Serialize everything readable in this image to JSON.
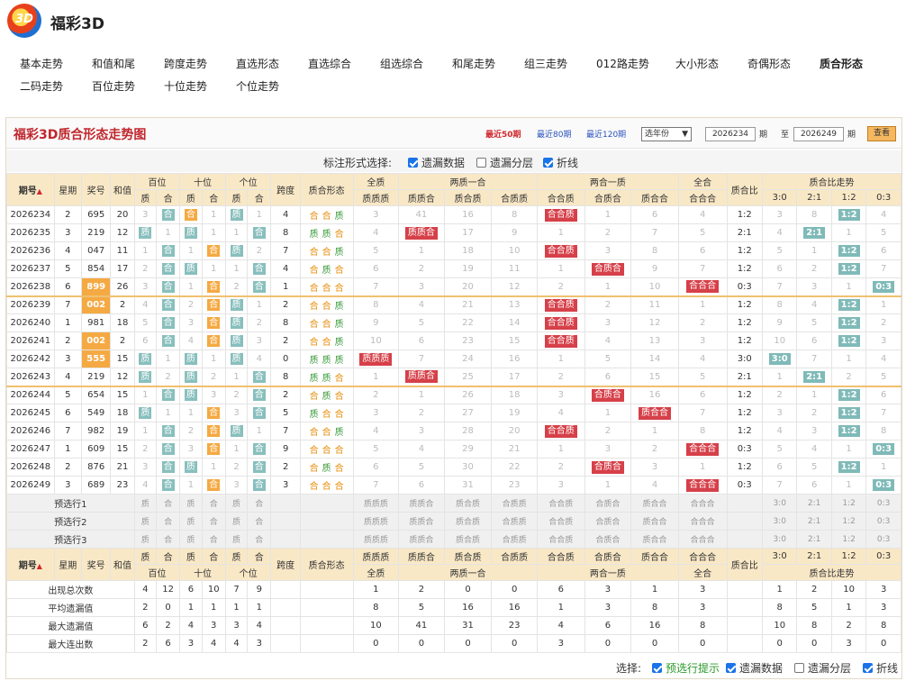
{
  "site": {
    "title": "福彩3D",
    "logo_text": "3D"
  },
  "nav": [
    {
      "label": "基本走势",
      "active": false
    },
    {
      "label": "和值和尾",
      "active": false
    },
    {
      "label": "跨度走势",
      "active": false
    },
    {
      "label": "直选形态",
      "active": false
    },
    {
      "label": "直选综合",
      "active": false
    },
    {
      "label": "组选综合",
      "active": false
    },
    {
      "label": "和尾走势",
      "active": false
    },
    {
      "label": "组三走势",
      "active": false
    },
    {
      "label": "012路走势",
      "active": false
    },
    {
      "label": "大小形态",
      "active": false
    },
    {
      "label": "奇偶形态",
      "active": false
    },
    {
      "label": "质合形态",
      "active": true
    },
    {
      "label": "二码走势",
      "active": false
    },
    {
      "label": "百位走势",
      "active": false
    },
    {
      "label": "十位走势",
      "active": false
    },
    {
      "label": "个位走势",
      "active": false
    }
  ],
  "panel": {
    "title": "福彩3D质合形态走势图",
    "ranges": [
      {
        "label": "最近50期",
        "active": true
      },
      {
        "label": "最近80期",
        "active": false
      },
      {
        "label": "最近120期",
        "active": false
      }
    ],
    "year_select": "选年份",
    "from_label": "期",
    "to_label": "至",
    "period_unit": "期",
    "period_from": "2026234",
    "period_to": "2026249",
    "view_button": "查看"
  },
  "mark": {
    "label": "标注形式选择:",
    "options": [
      {
        "label": "遗漏数据",
        "checked": true
      },
      {
        "label": "遗漏分层",
        "checked": false
      },
      {
        "label": "折线",
        "checked": true
      }
    ]
  },
  "header": {
    "period": "期号",
    "weekday": "星期",
    "number": "奖号",
    "sum": "和值",
    "hundreds": "百位",
    "tens": "十位",
    "units": "个位",
    "span": "跨度",
    "form": "质合形态",
    "all_prime": "全质",
    "two_prime": "两质一合",
    "two_comp": "两合一质",
    "all_comp": "全合",
    "ratio": "质合比",
    "ratio_trend": "质合比走势",
    "prime": "质",
    "comp": "合",
    "ppp": "质质质",
    "ppc": "质质合",
    "pcp": "质合质",
    "cpp": "合质质",
    "ccp": "合合质",
    "cpc": "合质合",
    "pcc": "质合合",
    "ccc": "合合合",
    "r30": "3:0",
    "r21": "2:1",
    "r12": "1:2",
    "r03": "0:3"
  },
  "rows": [
    {
      "period": "2026234",
      "weekday": "2",
      "number": "695",
      "sum": "20",
      "hl": false,
      "h": [
        "3",
        "合"
      ],
      "t": [
        "合",
        "1"
      ],
      "u": [
        "质",
        "1"
      ],
      "span": "4",
      "form": [
        "合",
        "合",
        "质"
      ],
      "cat": [
        "3",
        "41",
        "16",
        "8",
        "合合质",
        "1",
        "6",
        "4"
      ],
      "ratio": "1:2",
      "rt": [
        "3",
        "8",
        "1:2",
        "4"
      ]
    },
    {
      "period": "2026235",
      "weekday": "3",
      "number": "219",
      "sum": "12",
      "hl": false,
      "h": [
        "质",
        "1"
      ],
      "t": [
        "质",
        "1"
      ],
      "u": [
        "1",
        "合"
      ],
      "span": "8",
      "form": [
        "质",
        "质",
        "合"
      ],
      "cat": [
        "4",
        "质质合",
        "17",
        "9",
        "1",
        "2",
        "7",
        "5"
      ],
      "ratio": "2:1",
      "rt": [
        "4",
        "2:1",
        "1",
        "5"
      ]
    },
    {
      "period": "2026236",
      "weekday": "4",
      "number": "047",
      "sum": "11",
      "hl": false,
      "h": [
        "1",
        "合"
      ],
      "t": [
        "1",
        "合"
      ],
      "u": [
        "质",
        "2"
      ],
      "span": "7",
      "form": [
        "合",
        "合",
        "质"
      ],
      "cat": [
        "5",
        "1",
        "18",
        "10",
        "合合质",
        "3",
        "8",
        "6"
      ],
      "ratio": "1:2",
      "rt": [
        "5",
        "1",
        "1:2",
        "6"
      ]
    },
    {
      "period": "2026237",
      "weekday": "5",
      "number": "854",
      "sum": "17",
      "hl": false,
      "h": [
        "2",
        "合"
      ],
      "t": [
        "质",
        "1"
      ],
      "u": [
        "1",
        "合"
      ],
      "span": "4",
      "form": [
        "合",
        "质",
        "合"
      ],
      "cat": [
        "6",
        "2",
        "19",
        "11",
        "1",
        "合质合",
        "9",
        "7"
      ],
      "ratio": "1:2",
      "rt": [
        "6",
        "2",
        "1:2",
        "7"
      ]
    },
    {
      "period": "2026238",
      "weekday": "6",
      "number": "899",
      "sum": "26",
      "hl": true,
      "h": [
        "3",
        "合"
      ],
      "t": [
        "1",
        "合"
      ],
      "u": [
        "2",
        "合"
      ],
      "span": "1",
      "form": [
        "合",
        "合",
        "合"
      ],
      "cat": [
        "7",
        "3",
        "20",
        "12",
        "2",
        "1",
        "10",
        "合合合"
      ],
      "ratio": "0:3",
      "rt": [
        "7",
        "3",
        "1",
        "0:3"
      ]
    },
    {
      "period": "2026239",
      "weekday": "7",
      "number": "002",
      "sum": "2",
      "hl": true,
      "h": [
        "4",
        "合"
      ],
      "t": [
        "2",
        "合"
      ],
      "u": [
        "质",
        "1"
      ],
      "span": "2",
      "form": [
        "合",
        "合",
        "质"
      ],
      "cat": [
        "8",
        "4",
        "21",
        "13",
        "合合质",
        "2",
        "11",
        "1"
      ],
      "ratio": "1:2",
      "rt": [
        "8",
        "4",
        "1:2",
        "1"
      ]
    },
    {
      "period": "2026240",
      "weekday": "1",
      "number": "981",
      "sum": "18",
      "hl": false,
      "h": [
        "5",
        "合"
      ],
      "t": [
        "3",
        "合"
      ],
      "u": [
        "质",
        "2"
      ],
      "span": "8",
      "form": [
        "合",
        "合",
        "质"
      ],
      "cat": [
        "9",
        "5",
        "22",
        "14",
        "合合质",
        "3",
        "12",
        "2"
      ],
      "ratio": "1:2",
      "rt": [
        "9",
        "5",
        "1:2",
        "2"
      ]
    },
    {
      "period": "2026241",
      "weekday": "2",
      "number": "002",
      "sum": "2",
      "hl": true,
      "h": [
        "6",
        "合"
      ],
      "t": [
        "4",
        "合"
      ],
      "u": [
        "质",
        "3"
      ],
      "span": "2",
      "form": [
        "合",
        "合",
        "质"
      ],
      "cat": [
        "10",
        "6",
        "23",
        "15",
        "合合质",
        "4",
        "13",
        "3"
      ],
      "ratio": "1:2",
      "rt": [
        "10",
        "6",
        "1:2",
        "3"
      ]
    },
    {
      "period": "2026242",
      "weekday": "3",
      "number": "555",
      "sum": "15",
      "hl": true,
      "h": [
        "质",
        "1"
      ],
      "t": [
        "质",
        "1"
      ],
      "u": [
        "质",
        "4"
      ],
      "span": "0",
      "form": [
        "质",
        "质",
        "质"
      ],
      "cat": [
        "质质质",
        "7",
        "24",
        "16",
        "1",
        "5",
        "14",
        "4"
      ],
      "ratio": "3:0",
      "rt": [
        "3:0",
        "7",
        "1",
        "4"
      ]
    },
    {
      "period": "2026243",
      "weekday": "4",
      "number": "219",
      "sum": "12",
      "hl": false,
      "h": [
        "质",
        "2"
      ],
      "t": [
        "质",
        "2"
      ],
      "u": [
        "1",
        "合"
      ],
      "span": "8",
      "form": [
        "质",
        "质",
        "合"
      ],
      "cat": [
        "1",
        "质质合",
        "25",
        "17",
        "2",
        "6",
        "15",
        "5"
      ],
      "ratio": "2:1",
      "rt": [
        "1",
        "2:1",
        "2",
        "5"
      ]
    },
    {
      "period": "2026244",
      "weekday": "5",
      "number": "654",
      "sum": "15",
      "hl": false,
      "h": [
        "1",
        "合"
      ],
      "t": [
        "质",
        "3"
      ],
      "u": [
        "2",
        "合"
      ],
      "span": "2",
      "form": [
        "合",
        "质",
        "合"
      ],
      "cat": [
        "2",
        "1",
        "26",
        "18",
        "3",
        "合质合",
        "16",
        "6"
      ],
      "ratio": "1:2",
      "rt": [
        "2",
        "1",
        "1:2",
        "6"
      ]
    },
    {
      "period": "2026245",
      "weekday": "6",
      "number": "549",
      "sum": "18",
      "hl": false,
      "h": [
        "质",
        "1"
      ],
      "t": [
        "1",
        "合"
      ],
      "u": [
        "3",
        "合"
      ],
      "span": "5",
      "form": [
        "质",
        "合",
        "合"
      ],
      "cat": [
        "3",
        "2",
        "27",
        "19",
        "4",
        "1",
        "质合合",
        "7"
      ],
      "ratio": "1:2",
      "rt": [
        "3",
        "2",
        "1:2",
        "7"
      ]
    },
    {
      "period": "2026246",
      "weekday": "7",
      "number": "982",
      "sum": "19",
      "hl": false,
      "h": [
        "1",
        "合"
      ],
      "t": [
        "2",
        "合"
      ],
      "u": [
        "质",
        "1"
      ],
      "span": "7",
      "form": [
        "合",
        "合",
        "质"
      ],
      "cat": [
        "4",
        "3",
        "28",
        "20",
        "合合质",
        "2",
        "1",
        "8"
      ],
      "ratio": "1:2",
      "rt": [
        "4",
        "3",
        "1:2",
        "8"
      ]
    },
    {
      "period": "2026247",
      "weekday": "1",
      "number": "609",
      "sum": "15",
      "hl": false,
      "h": [
        "2",
        "合"
      ],
      "t": [
        "3",
        "合"
      ],
      "u": [
        "1",
        "合"
      ],
      "span": "9",
      "form": [
        "合",
        "合",
        "合"
      ],
      "cat": [
        "5",
        "4",
        "29",
        "21",
        "1",
        "3",
        "2",
        "合合合"
      ],
      "ratio": "0:3",
      "rt": [
        "5",
        "4",
        "1",
        "0:3"
      ]
    },
    {
      "period": "2026248",
      "weekday": "2",
      "number": "876",
      "sum": "21",
      "hl": false,
      "h": [
        "3",
        "合"
      ],
      "t": [
        "质",
        "1"
      ],
      "u": [
        "2",
        "合"
      ],
      "span": "2",
      "form": [
        "合",
        "质",
        "合"
      ],
      "cat": [
        "6",
        "5",
        "30",
        "22",
        "2",
        "合质合",
        "3",
        "1"
      ],
      "ratio": "1:2",
      "rt": [
        "6",
        "5",
        "1:2",
        "1"
      ]
    },
    {
      "period": "2026249",
      "weekday": "3",
      "number": "689",
      "sum": "23",
      "hl": false,
      "h": [
        "4",
        "合"
      ],
      "t": [
        "1",
        "合"
      ],
      "u": [
        "3",
        "合"
      ],
      "span": "3",
      "form": [
        "合",
        "合",
        "合"
      ],
      "cat": [
        "7",
        "6",
        "31",
        "23",
        "3",
        "1",
        "4",
        "合合合"
      ],
      "ratio": "0:3",
      "rt": [
        "7",
        "6",
        "1",
        "0:3"
      ]
    }
  ],
  "preselect": [
    {
      "label": "预选行1"
    },
    {
      "label": "预选行2"
    },
    {
      "label": "预选行3"
    }
  ],
  "stats": [
    {
      "label": "出现总次数",
      "v": [
        "4",
        "12",
        "6",
        "10",
        "7",
        "9"
      ],
      "c": [
        "1",
        "2",
        "0",
        "0",
        "6",
        "3",
        "1",
        "3"
      ],
      "r": [
        "1",
        "2",
        "10",
        "3"
      ]
    },
    {
      "label": "平均遗漏值",
      "v": [
        "2",
        "0",
        "1",
        "1",
        "1",
        "1"
      ],
      "c": [
        "8",
        "5",
        "16",
        "16",
        "1",
        "3",
        "8",
        "3"
      ],
      "r": [
        "8",
        "5",
        "1",
        "3"
      ]
    },
    {
      "label": "最大遗漏值",
      "v": [
        "6",
        "2",
        "4",
        "3",
        "3",
        "4"
      ],
      "c": [
        "10",
        "41",
        "31",
        "23",
        "4",
        "6",
        "16",
        "8"
      ],
      "r": [
        "10",
        "8",
        "2",
        "8"
      ]
    },
    {
      "label": "最大连出数",
      "v": [
        "2",
        "6",
        "3",
        "4",
        "4",
        "3"
      ],
      "c": [
        "0",
        "0",
        "0",
        "0",
        "3",
        "0",
        "0",
        "0"
      ],
      "r": [
        "0",
        "0",
        "3",
        "0"
      ]
    }
  ],
  "footer": {
    "label": "选择:",
    "options": [
      {
        "label": "预选行提示",
        "checked": true,
        "green": true
      },
      {
        "label": "遗漏数据",
        "checked": true,
        "green": false
      },
      {
        "label": "遗漏分层",
        "checked": false,
        "green": false
      },
      {
        "label": "折线",
        "checked": true,
        "green": false
      }
    ]
  }
}
